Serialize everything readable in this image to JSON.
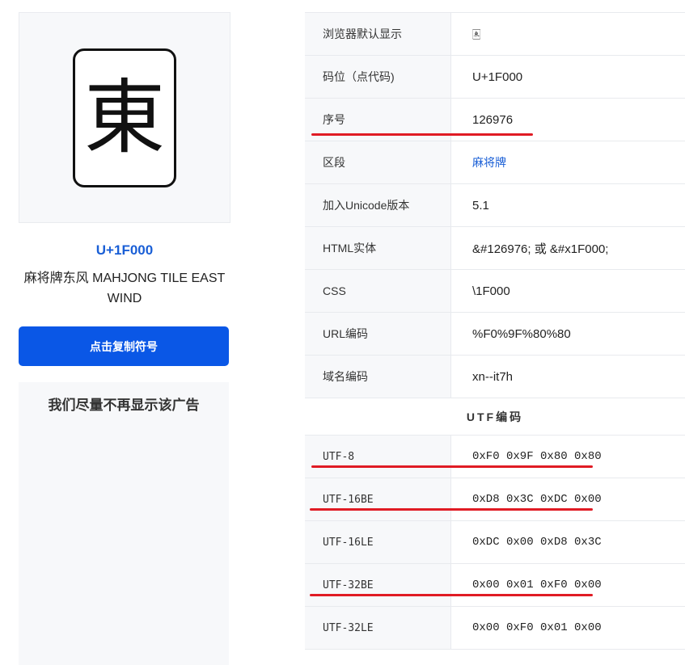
{
  "left": {
    "glyph": "東",
    "codepoint": "U+1F000",
    "char_name": "麻将牌东风 MAHJONG TILE EAST WIND",
    "copy_button": "点击复制符号",
    "ad_text": "我们尽量不再显示该广告"
  },
  "table": {
    "rows": [
      {
        "key": "浏览器默认显示",
        "value": "🀀"
      },
      {
        "key": "码位（点代码)",
        "value": "U+1F000"
      },
      {
        "key": "序号",
        "value": "126976"
      },
      {
        "key": "区段",
        "value": "麻将牌"
      },
      {
        "key": "加入Unicode版本",
        "value": "5.1"
      },
      {
        "key": "HTML实体",
        "value": "&#126976; 或 &#x1F000;"
      },
      {
        "key": "CSS",
        "value": "\\1F000"
      },
      {
        "key": "URL编码",
        "value": "%F0%9F%80%80"
      },
      {
        "key": "域名编码",
        "value": "xn--it7h"
      }
    ],
    "utf_section_title": "UTF编码",
    "utf_rows": [
      {
        "key": "UTF-8",
        "value": "0xF0 0x9F 0x80 0x80"
      },
      {
        "key": "UTF-16BE",
        "value": "0xD8 0x3C 0xDC 0x00"
      },
      {
        "key": "UTF-16LE",
        "value": "0xDC 0x00 0xD8 0x3C"
      },
      {
        "key": "UTF-32BE",
        "value": "0x00 0x01 0xF0 0x00"
      },
      {
        "key": "UTF-32LE",
        "value": "0x00 0xF0 0x01 0x00"
      }
    ]
  },
  "colors": {
    "accent": "#0a57e6",
    "link": "#1a5fd6",
    "annotation_red": "#e01b24",
    "panel_bg": "#f7f8fa"
  }
}
